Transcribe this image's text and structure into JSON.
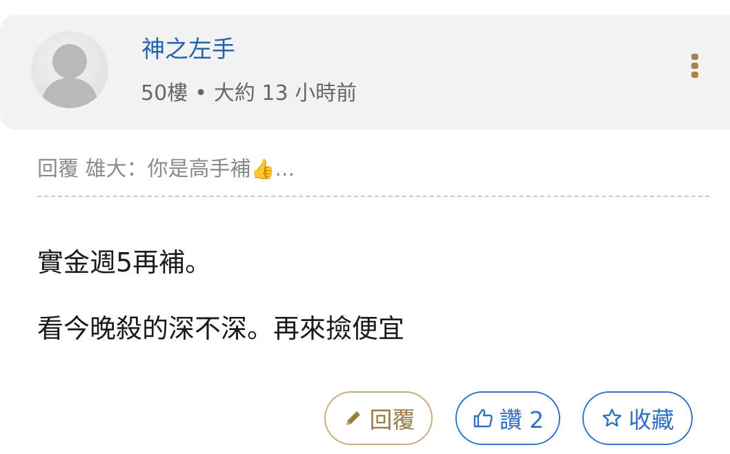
{
  "post": {
    "username": "神之左手",
    "floor": "50樓",
    "separator": "•",
    "time_ago": "大約 13 小時前",
    "more_icon": "more-vertical-icon",
    "reply_quote": {
      "text": "回覆 雄大：你是高手補",
      "emoji": "👍",
      "ellipsis": "..."
    },
    "content": [
      "實金週5再補。",
      "看今晚殺的深不深。再來撿便宜"
    ]
  },
  "actions": {
    "reply_label": "回覆",
    "like_label": "讚 2",
    "favorite_label": "收藏"
  },
  "colors": {
    "username": "#2563ad",
    "header_bg": "#f2f2f2",
    "gold_accent": "#a8824f",
    "blue_accent": "#2f73c9"
  }
}
